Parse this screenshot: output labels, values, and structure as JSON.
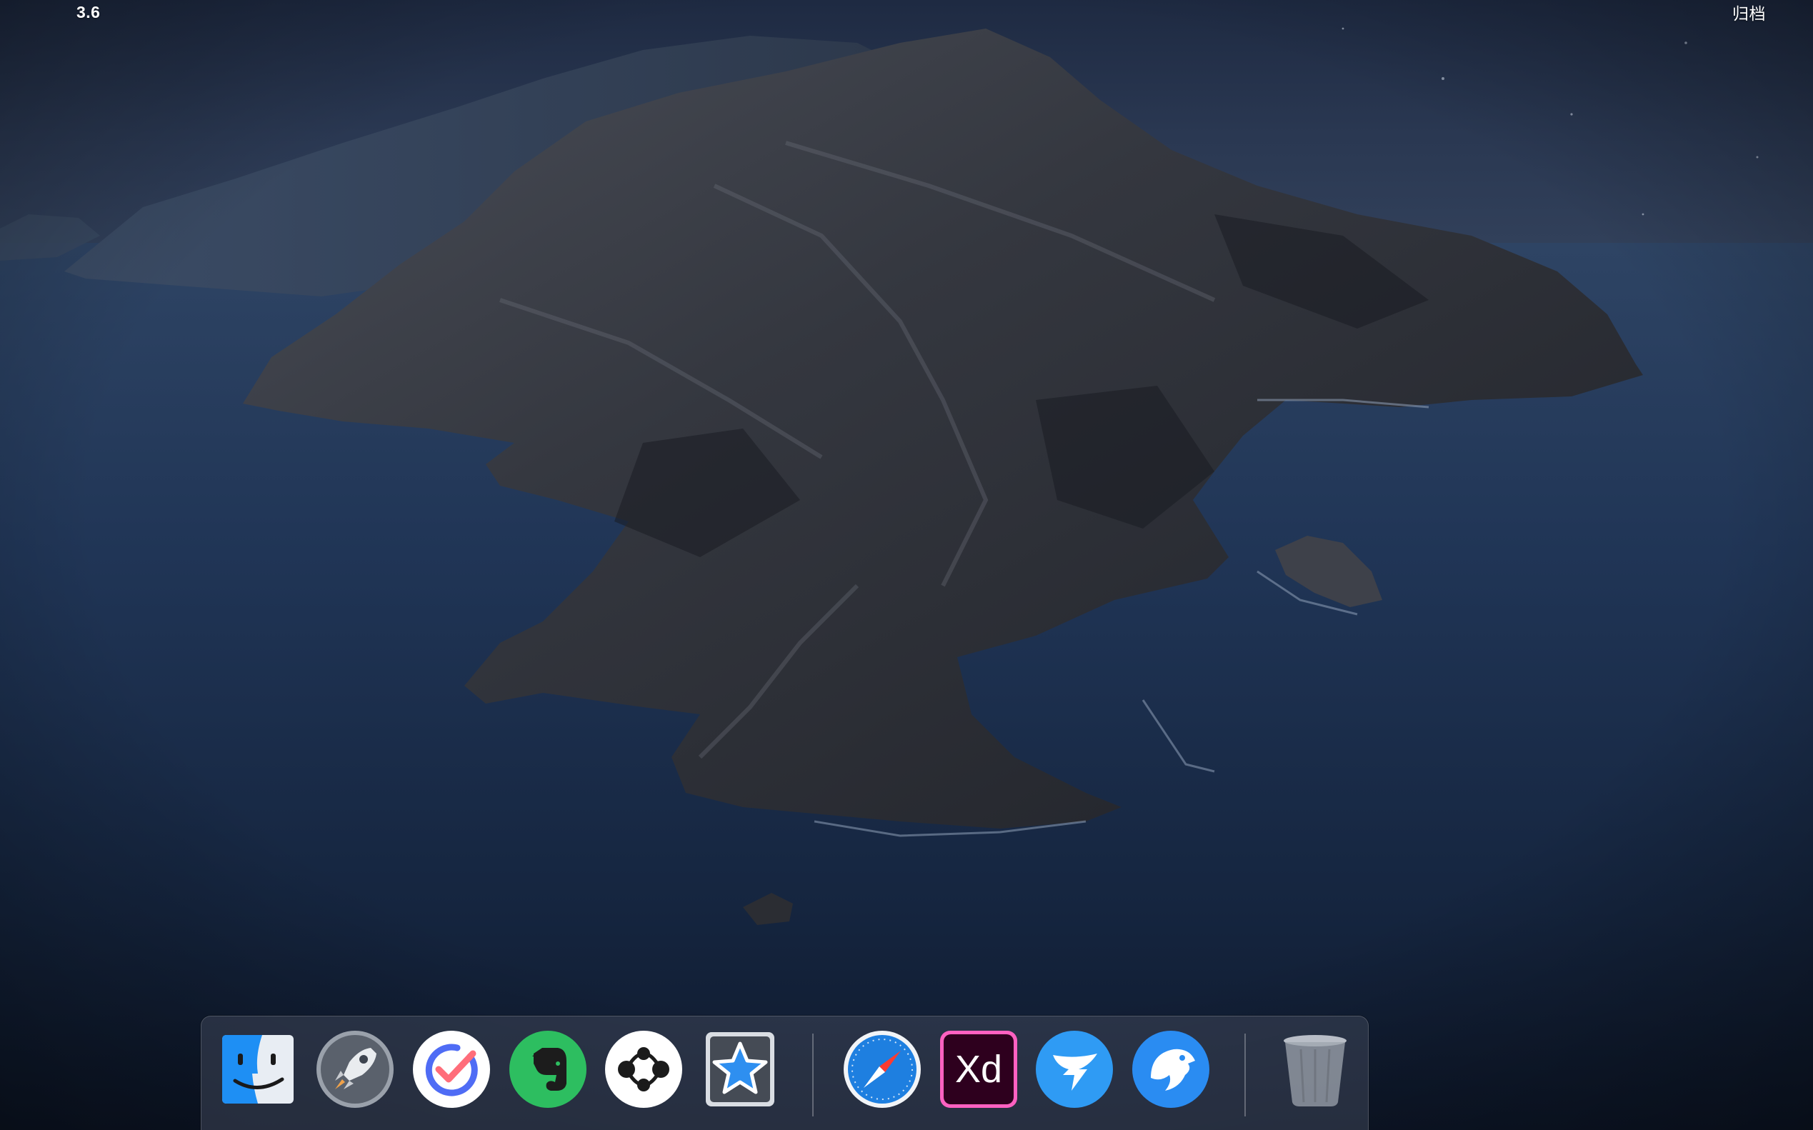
{
  "desktop": {
    "menu_left_text": "3.6",
    "menu_right_text": "归档"
  },
  "dock": {
    "items": [
      {
        "name": "finder",
        "running": true
      },
      {
        "name": "launchpad",
        "running": false
      },
      {
        "name": "ticktick",
        "running": false
      },
      {
        "name": "evernote",
        "running": false
      },
      {
        "name": "mindnode",
        "running": false
      },
      {
        "name": "reeder",
        "running": false
      },
      {
        "name": "safari",
        "running": true
      },
      {
        "name": "adobe-xd",
        "running": true
      },
      {
        "name": "dingtalk",
        "running": true
      },
      {
        "name": "eagle",
        "running": true
      },
      {
        "name": "trash",
        "running": false
      }
    ],
    "icons": {
      "adobe_xd_text": "Xd"
    }
  },
  "colors": {
    "sky": "#1a2236",
    "sea": "#1b2c48",
    "xd_pink": "#ff61c1",
    "evernote_green": "#2dbe60",
    "safari_blue": "#1e7fe0",
    "dingtalk_blue": "#2f9bf4",
    "eagle_blue": "#2a8cf2"
  }
}
